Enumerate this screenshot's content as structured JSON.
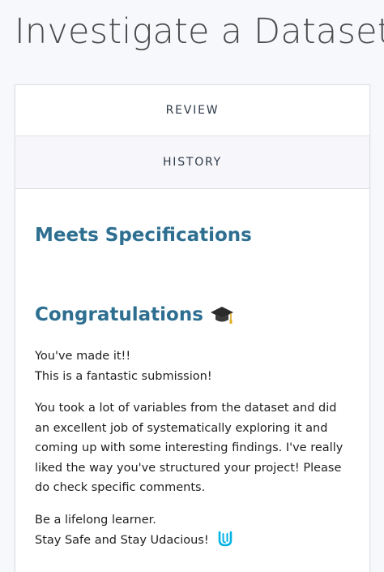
{
  "page": {
    "title": "Investigate a Dataset"
  },
  "tabs": {
    "review": "REVIEW",
    "history": "HISTORY"
  },
  "review": {
    "status_heading": "Meets Specifications",
    "congrats_heading": "Congratulations",
    "congrats_icon": "graduation-cap-icon",
    "line1": "You've made it!!",
    "line2": "This is a fantastic submission!",
    "paragraph": "You took a lot of variables from the dataset and did an excellent job of systematically exploring it and coming up with some interesting findings. I've really liked the way you've structured your project! Please do check specific comments.",
    "closing1": "Be a lifelong learner.",
    "closing2": "Stay Safe and Stay Udacious!",
    "closing_icon": "udacity-logo-icon"
  },
  "colors": {
    "heading": "#2e6f91",
    "title": "#4a4a4a",
    "udacity_blue": "#02b3e4"
  }
}
